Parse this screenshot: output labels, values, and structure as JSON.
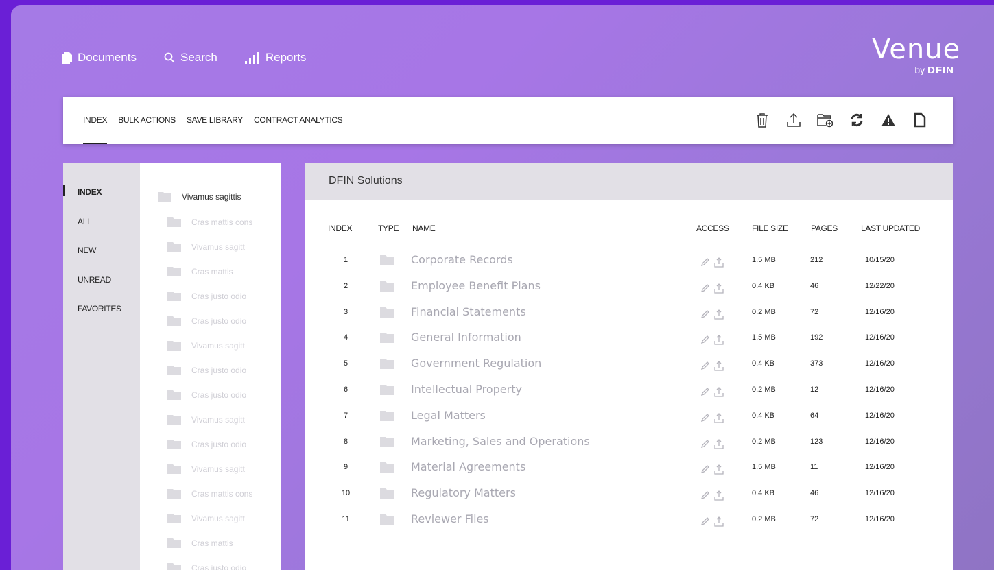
{
  "nav": {
    "items": [
      {
        "label": "Documents",
        "icon": "documents-icon"
      },
      {
        "label": "Search",
        "icon": "search-icon"
      },
      {
        "label": "Reports",
        "icon": "bar-chart-icon"
      }
    ]
  },
  "brand": {
    "name": "Venue",
    "by": "by",
    "company": "DFIN"
  },
  "toolbar": {
    "tabs": [
      "INDEX",
      "BULK ACTIONS",
      "SAVE LIBRARY",
      "CONTRACT ANALYTICS"
    ],
    "active_tab": "INDEX",
    "icons": [
      "trash-icon",
      "upload-icon",
      "add-folder-icon",
      "refresh-icon",
      "warning-icon",
      "document-icon"
    ]
  },
  "filters": {
    "items": [
      "INDEX",
      "ALL",
      "NEW",
      "UNREAD",
      "FAVORITES"
    ],
    "active": "INDEX"
  },
  "tree": {
    "root": "Vivamus sagittis",
    "children": [
      "Cras mattis cons",
      "Vivamus sagitt",
      "Cras mattis",
      "Cras justo odio",
      "Cras justo odio",
      "Vivamus sagitt",
      "Cras justo odio",
      "Cras justo odio",
      "Vivamus sagitt",
      "Cras justo odio",
      "Vivamus sagitt",
      "Cras mattis cons",
      "Vivamus sagitt",
      "Cras mattis",
      "Cras justo odio"
    ]
  },
  "panel": {
    "title": "DFIN Solutions",
    "columns": {
      "index": "INDEX",
      "type": "TYPE",
      "name": "NAME",
      "access": "ACCESS",
      "file_size": "FILE SIZE",
      "pages": "PAGES",
      "last_updated": "LAST UPDATED"
    },
    "rows": [
      {
        "index": "1",
        "name": "Corporate Records",
        "size": "1.5 MB",
        "pages": "212",
        "updated": "10/15/20"
      },
      {
        "index": "2",
        "name": "Employee Benefit Plans",
        "size": "0.4 KB",
        "pages": "46",
        "updated": "12/22/20"
      },
      {
        "index": "3",
        "name": "Financial Statements",
        "size": "0.2 MB",
        "pages": "72",
        "updated": "12/16/20"
      },
      {
        "index": "4",
        "name": "General Information",
        "size": "1.5 MB",
        "pages": "192",
        "updated": "12/16/20"
      },
      {
        "index": "5",
        "name": "Government Regulation",
        "size": "0.4 KB",
        "pages": "373",
        "updated": "12/16/20"
      },
      {
        "index": "6",
        "name": "Intellectual Property",
        "size": "0.2 MB",
        "pages": "12",
        "updated": "12/16/20"
      },
      {
        "index": "7",
        "name": "Legal Matters",
        "size": "0.4 KB",
        "pages": "64",
        "updated": "12/16/20"
      },
      {
        "index": "8",
        "name": "Marketing, Sales and Operations",
        "size": "0.2 MB",
        "pages": "123",
        "updated": "12/16/20"
      },
      {
        "index": "9",
        "name": "Material Agreements",
        "size": "1.5 MB",
        "pages": "11",
        "updated": "12/16/20"
      },
      {
        "index": "10",
        "name": "Regulatory Matters",
        "size": "0.4 KB",
        "pages": "46",
        "updated": "12/16/20"
      },
      {
        "index": "11",
        "name": "Reviewer Files",
        "size": "0.2 MB",
        "pages": "72",
        "updated": "12/16/20"
      }
    ]
  },
  "colors": {
    "background": "#6a1fd6",
    "frame": "#a57ae6",
    "panel_header": "#e2e0e6",
    "folder": "#dcdbe0"
  }
}
